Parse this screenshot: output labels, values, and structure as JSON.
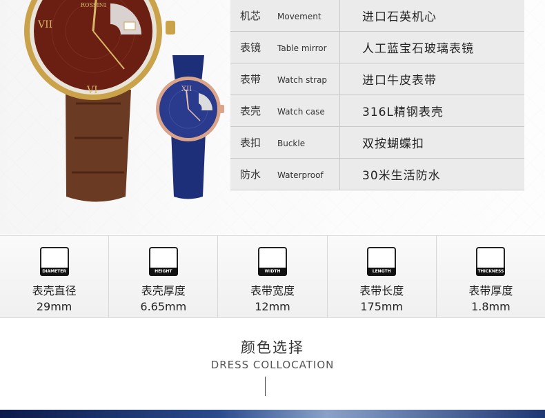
{
  "brand": "ROSSINI",
  "specs": [
    {
      "cn": "机芯",
      "en": "Movement",
      "value": "进口石英机心"
    },
    {
      "cn": "表镜",
      "en": "Table mirror",
      "value": "人工蓝宝石玻璃表镜"
    },
    {
      "cn": "表带",
      "en": "Watch strap",
      "value": "进口牛皮表带"
    },
    {
      "cn": "表壳",
      "en": "Watch case",
      "value": "316L精钢表壳"
    },
    {
      "cn": "表扣",
      "en": "Buckle",
      "value": "双按蝴蝶扣"
    },
    {
      "cn": "防水",
      "en": "Waterproof",
      "value": "30米生活防水"
    }
  ],
  "dimensions": [
    {
      "icon": "watch-diameter-icon",
      "tag": "DIAMETER",
      "label": "表壳直径",
      "value": "29mm"
    },
    {
      "icon": "watch-height-icon",
      "tag": "HEIGHT",
      "label": "表壳厚度",
      "value": "6.65mm"
    },
    {
      "icon": "strap-width-icon",
      "tag": "WIDTH",
      "label": "表带宽度",
      "value": "12mm"
    },
    {
      "icon": "strap-length-icon",
      "tag": "LENGTH",
      "label": "表带长度",
      "value": "175mm"
    },
    {
      "icon": "strap-thickness-icon",
      "tag": "THICKNESS",
      "label": "表带厚度",
      "value": "1.8mm"
    }
  ],
  "section": {
    "title": "颜色选择",
    "subtitle": "DRESS COLLOCATION"
  },
  "colors": {
    "table_bg": "#ebebeb",
    "gold": "#c9a24a",
    "brown_strap": "#6e3a22",
    "blue_strap": "#1e2f7a"
  }
}
